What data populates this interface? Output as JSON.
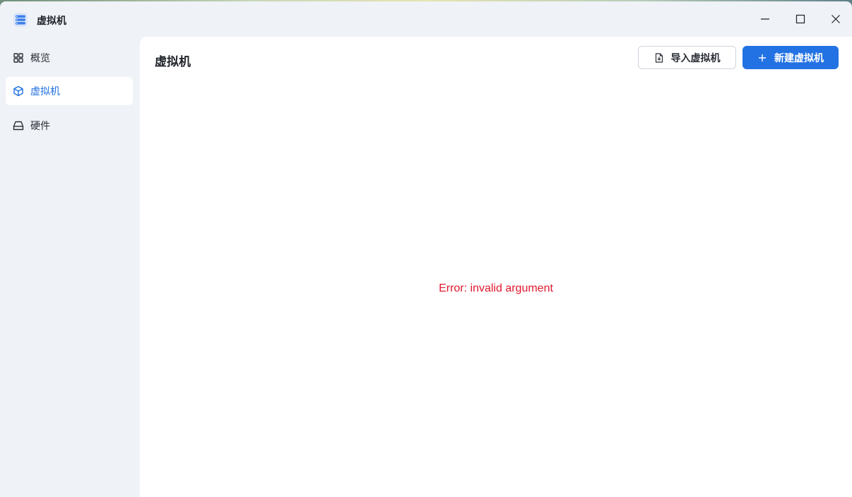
{
  "app": {
    "title": "虚拟机",
    "icon": "server-stack-icon",
    "accent_color": "#2272e3",
    "error_color": "#e0182e"
  },
  "window_controls": {
    "minimize": "minimize-icon",
    "maximize": "maximize-icon",
    "close": "close-icon"
  },
  "sidebar": {
    "items": [
      {
        "label": "概览",
        "icon": "grid-icon",
        "active": false
      },
      {
        "label": "虚拟机",
        "icon": "cube-icon",
        "active": true
      },
      {
        "label": "硬件",
        "icon": "drive-icon",
        "active": false
      }
    ]
  },
  "main": {
    "title": "虚拟机",
    "import_button": {
      "label": "导入虚拟机",
      "icon": "file-import-icon"
    },
    "new_button": {
      "label": "新建虚拟机",
      "icon": "plus-icon"
    },
    "error_message": "Error: invalid argument"
  }
}
